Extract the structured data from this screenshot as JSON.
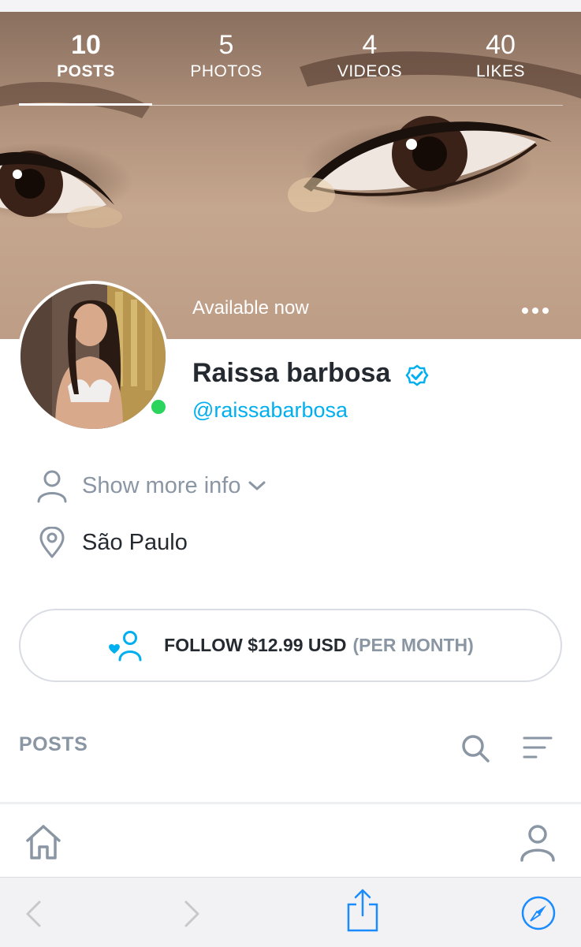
{
  "stats": [
    {
      "value": "10",
      "label": "POSTS",
      "active": true
    },
    {
      "value": "5",
      "label": "PHOTOS",
      "active": false
    },
    {
      "value": "4",
      "label": "VIDEOS",
      "active": false
    },
    {
      "value": "40",
      "label": "LIKES",
      "active": false
    }
  ],
  "profile": {
    "status": "Available now",
    "name": "Raissa barbosa",
    "handle": "@raissabarbosa",
    "show_more_info": "Show more info",
    "location": "São Paulo"
  },
  "follow": {
    "label": "FOLLOW $12.99 USD",
    "period": "(PER MONTH)"
  },
  "posts_section": {
    "title": "POSTS"
  },
  "colors": {
    "accent": "#00aff0",
    "online": "#2bd45c",
    "muted": "#8a96a3",
    "text": "#242a30"
  },
  "icons": {
    "more": "more-dots-icon",
    "verified": "verified-check-icon",
    "user": "user-icon",
    "location": "location-pin-icon",
    "follow": "follow-heart-user-icon",
    "search": "search-icon",
    "sort": "sort-lines-icon",
    "home": "home-icon",
    "profile": "profile-icon",
    "back": "chevron-left-icon",
    "forward": "chevron-right-icon",
    "share": "share-icon",
    "compass": "compass-icon"
  }
}
